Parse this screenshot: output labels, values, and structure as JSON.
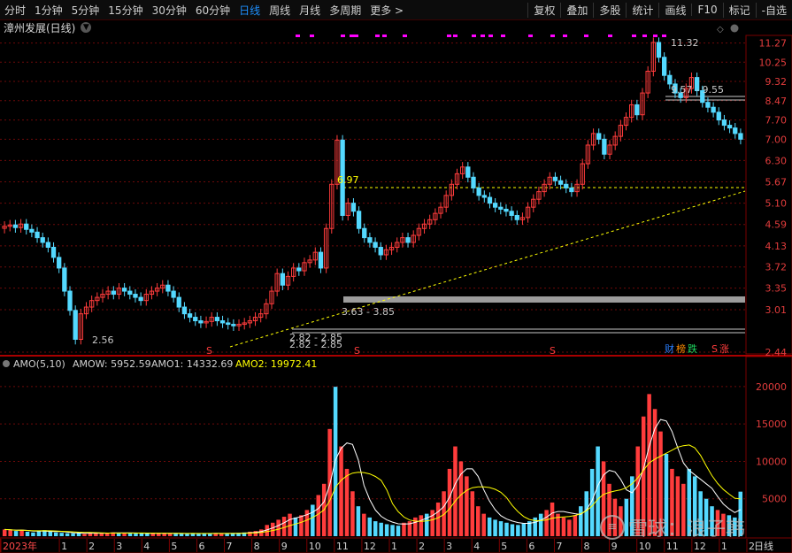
{
  "toolbar": {
    "periods": [
      "分时",
      "1分钟",
      "5分钟",
      "15分钟",
      "30分钟",
      "60分钟",
      "日线",
      "周线",
      "月线",
      "多周期",
      "更多 >"
    ],
    "active": "日线",
    "tools": [
      "复权",
      "叠加",
      "多股",
      "统计",
      "画线",
      "F10",
      "标记",
      "-自选"
    ]
  },
  "stock": {
    "title": "漳州发展(日线)"
  },
  "price_axis": {
    "ticks": [
      "11.27",
      "10.25",
      "9.32",
      "8.47",
      "7.70",
      "7.00",
      "6.30",
      "5.67",
      "5.10",
      "4.59",
      "4.13",
      "3.72",
      "3.35",
      "3.01",
      "2.44"
    ]
  },
  "annotations": {
    "high": "11.32",
    "low": "2.56",
    "peak_69": "6.97",
    "band_957": "9.57 - 9.55",
    "band_363": "3.63 - 3.85",
    "band_282": "2.82 - 2.85",
    "band_282b": "2.82 - 2.85"
  },
  "signals": {
    "s_marks": [
      "S",
      "S",
      "S",
      "S"
    ],
    "badges": [
      "财",
      "榜",
      "跌",
      "S",
      "涨"
    ]
  },
  "volume": {
    "header": {
      "name": "AMO(5,10)",
      "amow": "AMOW: 5952.59",
      "amo1": "AMO1: 14332.69",
      "amo2": "AMO2: 19972.41"
    },
    "ticks": [
      "20000",
      "15000",
      "10000",
      "5000"
    ]
  },
  "date_axis": {
    "labels": [
      "2023年",
      "1",
      "2",
      "3",
      "4",
      "5",
      "6",
      "7",
      "8",
      "9",
      "10",
      "11",
      "12",
      "1",
      "2",
      "3",
      "4",
      "5",
      "6",
      "7",
      "8",
      "9",
      "10",
      "11",
      "12",
      "1",
      "2"
    ],
    "period_label": "日线"
  },
  "watermark": {
    "text": "雪球：浪子韩",
    "logo": "≡"
  },
  "colors": {
    "up": "#ff3c3c",
    "down": "#54d9ff",
    "amo1": "#ffffff",
    "amo2": "#ffff00",
    "grid": "#6e0a0a"
  },
  "chart_data": [
    {
      "type": "candlestick",
      "title": "漳州发展(日线)",
      "ylim": [
        2.44,
        11.6
      ],
      "y_scale": "log",
      "series": [
        {
          "name": "K",
          "values": [
            4.55,
            4.58,
            4.52,
            4.6,
            4.48,
            4.42,
            4.3,
            4.2,
            4.1,
            3.9,
            3.7,
            3.3,
            3.0,
            2.6,
            2.95,
            3.05,
            3.15,
            3.2,
            3.25,
            3.3,
            3.25,
            3.35,
            3.3,
            3.25,
            3.2,
            3.15,
            3.25,
            3.3,
            3.35,
            3.4,
            3.3,
            3.2,
            3.05,
            2.95,
            2.9,
            2.85,
            2.82,
            2.84,
            2.9,
            2.85,
            2.82,
            2.8,
            2.78,
            2.8,
            2.82,
            2.85,
            2.9,
            2.95,
            3.1,
            3.3,
            3.6,
            3.4,
            3.55,
            3.7,
            3.65,
            3.8,
            3.85,
            4.0,
            3.7,
            4.5,
            5.6,
            6.97,
            4.8,
            5.1,
            4.9,
            4.5,
            4.3,
            4.2,
            4.1,
            3.95,
            4.05,
            4.1,
            4.2,
            4.3,
            4.2,
            4.35,
            4.5,
            4.6,
            4.7,
            4.85,
            5.0,
            5.3,
            5.6,
            5.9,
            6.1,
            5.8,
            5.5,
            5.3,
            5.25,
            5.1,
            5.0,
            4.95,
            4.9,
            4.8,
            4.7,
            4.75,
            5.0,
            5.2,
            5.4,
            5.6,
            5.8,
            5.7,
            5.6,
            5.5,
            5.4,
            5.6,
            6.2,
            6.8,
            7.2,
            7.0,
            6.5,
            6.8,
            7.1,
            7.5,
            7.8,
            8.3,
            7.9,
            8.8,
            9.8,
            11.3,
            10.5,
            9.6,
            9.2,
            8.8,
            8.6,
            9.0,
            9.5,
            8.9,
            8.4,
            8.2,
            8.0,
            7.7,
            7.5,
            7.4,
            7.2,
            7.0
          ]
        }
      ]
    },
    {
      "type": "bar",
      "title": "AMO(5,10)",
      "ylim": [
        0,
        22000
      ],
      "series": [
        {
          "name": "AMOW",
          "values": [
            900,
            800,
            700,
            850,
            600,
            500,
            700,
            800,
            600,
            500,
            450,
            400,
            380,
            420,
            300,
            500,
            400,
            380,
            420,
            500,
            460,
            400,
            380,
            360,
            400,
            420,
            380,
            360,
            400,
            380,
            350,
            320,
            300,
            420,
            380,
            360,
            340,
            400,
            380,
            360,
            400,
            420,
            500,
            600,
            700,
            900,
            1500,
            1800,
            2200,
            2600,
            3000,
            2500,
            2800,
            3500,
            4200,
            5500,
            7000,
            14332.69,
            19972.41,
            12000,
            9000,
            6000,
            4000,
            3000,
            2500,
            2000,
            1800,
            1600,
            1500,
            1400,
            1800,
            2000,
            2500,
            2800,
            3000,
            3500,
            4500,
            6000,
            9000,
            12000,
            10000,
            8000,
            6000,
            4000,
            3000,
            2500,
            2200,
            2000,
            1800,
            1600,
            1500,
            1700,
            2000,
            2500,
            3000,
            3500,
            4500,
            3000,
            2500,
            2200,
            2800,
            4000,
            6000,
            9000,
            12000,
            10000,
            7000,
            5000,
            4000,
            5000,
            8000,
            12000,
            16000,
            19000,
            17000,
            14000,
            11000,
            9000,
            8000,
            7000,
            9000,
            8000,
            6000,
            5000,
            4000,
            3500,
            3000,
            2800,
            2500,
            5952.59
          ]
        }
      ]
    }
  ]
}
